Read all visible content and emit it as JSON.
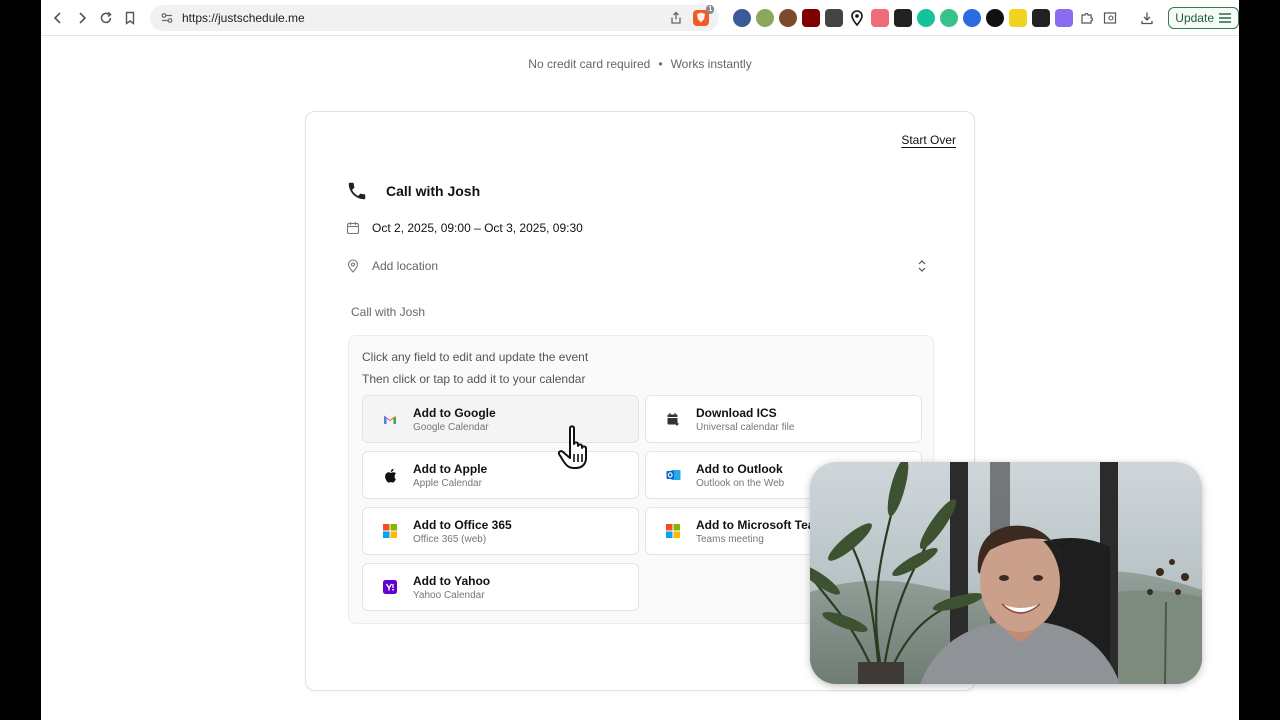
{
  "browser": {
    "url": "https://justschedule.me",
    "shield_badge": "1",
    "update_label": "Update"
  },
  "page": {
    "tagline_left": "No credit card required",
    "tagline_right": "Works instantly",
    "start_over": "Start Over",
    "event": {
      "title": "Call with Josh",
      "datetime": "Oct 2, 2025, 09:00 – Oct 3, 2025, 09:30",
      "location_placeholder": "Add location",
      "description": "Call with Josh"
    },
    "panel": {
      "hint1": "Click any field to edit and update the event",
      "hint2": "Then click or tap to add it to your calendar",
      "buttons": [
        {
          "main": "Add to Google",
          "sub": "Google Calendar",
          "icon": "gmail-icon"
        },
        {
          "main": "Download ICS",
          "sub": "Universal calendar file",
          "icon": "calendar-download-icon"
        },
        {
          "main": "Add to Apple",
          "sub": "Apple Calendar",
          "icon": "apple-icon"
        },
        {
          "main": "Add to Outlook",
          "sub": "Outlook on the Web",
          "icon": "outlook-icon"
        },
        {
          "main": "Add to Office 365",
          "sub": "Office 365 (web)",
          "icon": "microsoft-icon"
        },
        {
          "main": "Add to Microsoft Teams",
          "sub": "Teams meeting",
          "icon": "microsoft-icon"
        },
        {
          "main": "Add to Yahoo",
          "sub": "Yahoo Calendar",
          "icon": "yahoo-icon"
        }
      ]
    }
  },
  "colors": {
    "yahoo": "#5f01d1",
    "outlook": "#0a64c2",
    "ms_red": "#f25022",
    "ms_green": "#7fba00",
    "ms_blue": "#00a4ef",
    "ms_yellow": "#ffb900"
  }
}
